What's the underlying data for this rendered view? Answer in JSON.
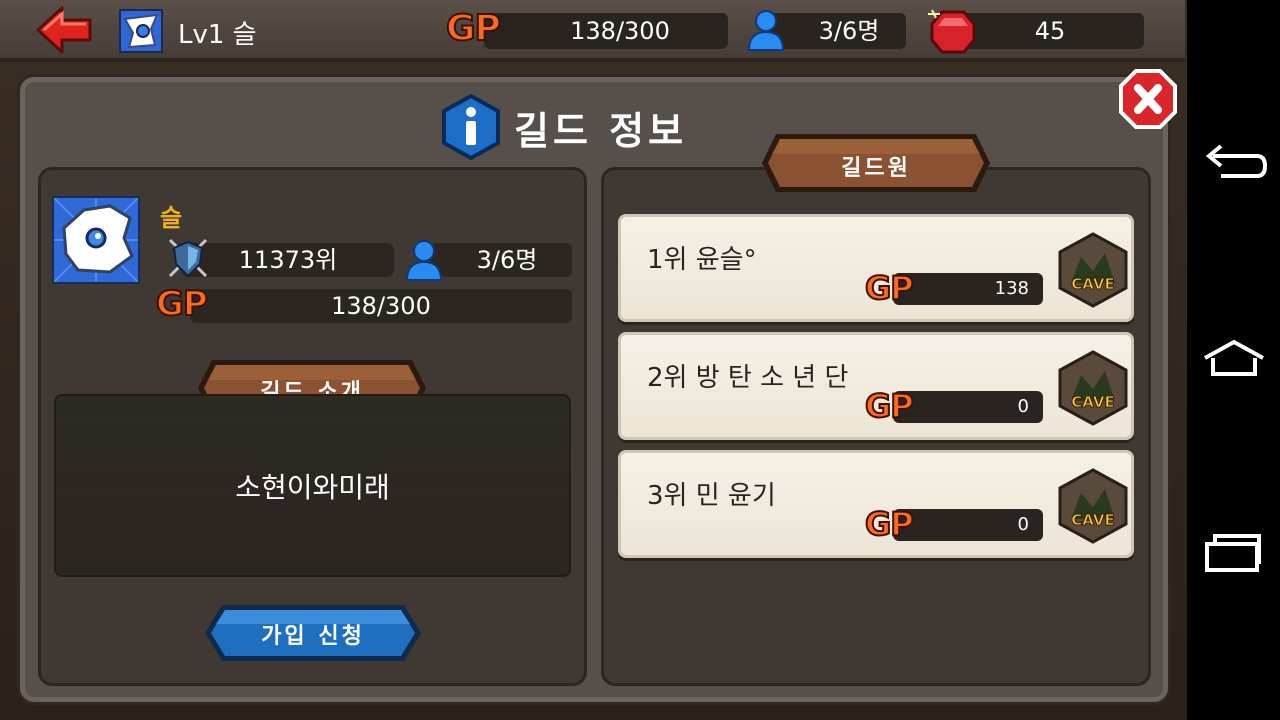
{
  "topbar": {
    "level_name": "Lv1 슬",
    "gp_label": "GP",
    "gp_value": "138/300",
    "members_value": "3/6명",
    "gems_value": "45"
  },
  "panel": {
    "title": "길드 정보"
  },
  "guild": {
    "name": "슬",
    "rank": "11373위",
    "members": "3/6명",
    "gp_label": "GP",
    "gp_value": "138/300",
    "intro_label": "길드 소개",
    "intro_text": "소현이와미래",
    "join_button": "가입 신청"
  },
  "members_section": {
    "label": "길드원",
    "members": [
      {
        "name": "1위 윤슬°",
        "gp_label": "GP",
        "gp": "138",
        "badge": "CAVE"
      },
      {
        "name": "2위 방 탄 소 년 단",
        "gp_label": "GP",
        "gp": "0",
        "badge": "CAVE"
      },
      {
        "name": "3위 민 윤기",
        "gp_label": "GP",
        "gp": "0",
        "badge": "CAVE"
      }
    ]
  },
  "icons": {
    "back": "back-arrow-icon",
    "close": "close-icon",
    "info": "info-icon",
    "person": "person-icon",
    "gem": "ruby-gem-icon",
    "shield": "shield-icon"
  },
  "colors": {
    "gp_orange": "#ff6a1a",
    "guild_name": "#f2b318",
    "ribbon_brown": "#8a5230",
    "join_blue": "#1f6fc0",
    "close_red": "#d8262a"
  }
}
